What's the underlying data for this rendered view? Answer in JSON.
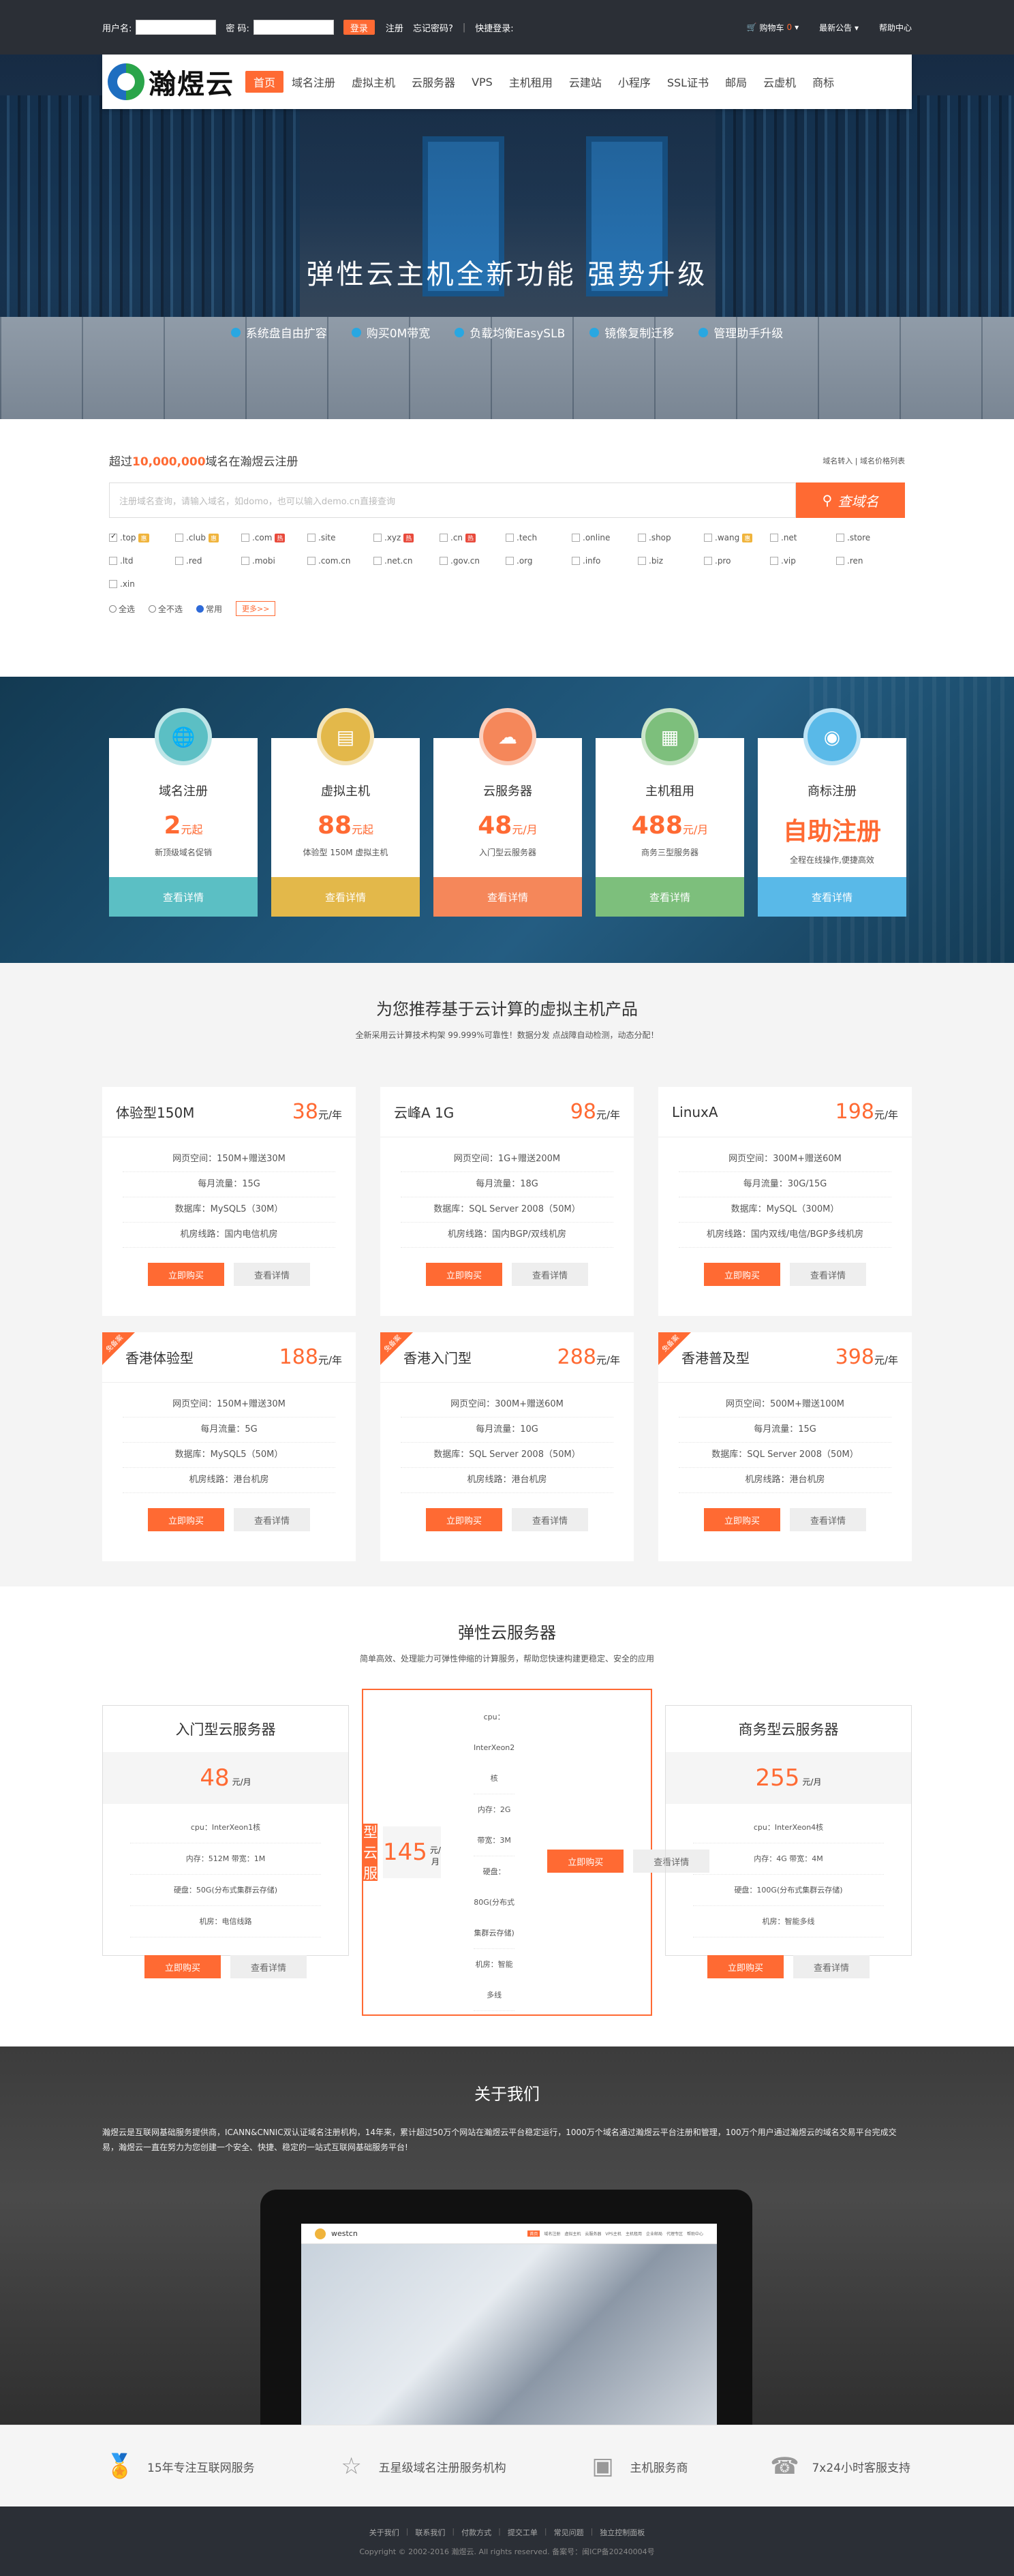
{
  "topbar": {
    "username_label": "用户名:",
    "password_label": "密 码:",
    "login_btn": "登录",
    "register": "注册",
    "forgot": "忘记密码?",
    "sep": "|",
    "quick_login": "快捷登录:",
    "cart_label": "购物车",
    "cart_count": "0",
    "notice": "最新公告",
    "help": "帮助中心"
  },
  "nav": {
    "logo_text": "瀚煜云",
    "items": [
      {
        "label": "首页"
      },
      {
        "label": "域名注册"
      },
      {
        "label": "虚拟主机"
      },
      {
        "label": "云服务器"
      },
      {
        "label": "VPS"
      },
      {
        "label": "主机租用"
      },
      {
        "label": "云建站"
      },
      {
        "label": "小程序"
      },
      {
        "label": "SSL证书"
      },
      {
        "label": "邮局"
      },
      {
        "label": "云虚机"
      },
      {
        "label": "商标"
      }
    ]
  },
  "hero": {
    "title": "弹性云主机全新功能  强势升级",
    "features": [
      "系统盘自由扩容",
      "购买0M带宽",
      "负载均衡EasySLB",
      "镜像复制迁移",
      "管理助手升级"
    ]
  },
  "domain": {
    "title_prefix": "超过",
    "title_count": "10,000,000",
    "title_suffix": "域名在瀚煜云注册",
    "link_transfer": "域名转入",
    "link_sep": "|",
    "link_price": "域名价格列表",
    "placeholder": "注册域名查询，请输入域名，如domo，也可以输入demo.cn直接查询",
    "search_btn": "查域名",
    "tlds": [
      {
        "name": ".top",
        "checked": true,
        "tag": "惠",
        "tag_type": "sale"
      },
      {
        "name": ".club",
        "checked": false,
        "tag": "惠",
        "tag_type": "sale"
      },
      {
        "name": ".com",
        "checked": false,
        "tag": "热",
        "tag_type": "new"
      },
      {
        "name": ".site",
        "checked": false,
        "tag": "",
        "tag_type": ""
      },
      {
        "name": ".xyz",
        "checked": false,
        "tag": "热",
        "tag_type": "new"
      },
      {
        "name": ".cn",
        "checked": false,
        "tag": "热",
        "tag_type": "new"
      },
      {
        "name": ".tech",
        "checked": false,
        "tag": "",
        "tag_type": ""
      },
      {
        "name": ".online",
        "checked": false,
        "tag": "",
        "tag_type": ""
      },
      {
        "name": ".shop",
        "checked": false,
        "tag": "",
        "tag_type": ""
      },
      {
        "name": ".wang",
        "checked": false,
        "tag": "惠",
        "tag_type": "sale"
      },
      {
        "name": ".net",
        "checked": false,
        "tag": "",
        "tag_type": ""
      },
      {
        "name": ".store",
        "checked": false,
        "tag": "",
        "tag_type": ""
      },
      {
        "name": ".ltd",
        "checked": false,
        "tag": "",
        "tag_type": ""
      },
      {
        "name": ".red",
        "checked": false,
        "tag": "",
        "tag_type": ""
      },
      {
        "name": ".mobi",
        "checked": false,
        "tag": "",
        "tag_type": ""
      },
      {
        "name": ".com.cn",
        "checked": false,
        "tag": "",
        "tag_type": ""
      },
      {
        "name": ".net.cn",
        "checked": false,
        "tag": "",
        "tag_type": ""
      },
      {
        "name": ".gov.cn",
        "checked": false,
        "tag": "",
        "tag_type": ""
      },
      {
        "name": ".org",
        "checked": false,
        "tag": "",
        "tag_type": ""
      },
      {
        "name": ".info",
        "checked": false,
        "tag": "",
        "tag_type": ""
      },
      {
        "name": ".biz",
        "checked": false,
        "tag": "",
        "tag_type": ""
      },
      {
        "name": ".pro",
        "checked": false,
        "tag": "",
        "tag_type": ""
      },
      {
        "name": ".vip",
        "checked": false,
        "tag": "",
        "tag_type": ""
      },
      {
        "name": ".ren",
        "checked": false,
        "tag": "",
        "tag_type": ""
      },
      {
        "name": ".xin",
        "checked": false,
        "tag": "",
        "tag_type": ""
      }
    ],
    "opt_all": "全选",
    "opt_none": "全不选",
    "opt_common": "常用",
    "more": "更多>>"
  },
  "services": [
    {
      "name": "域名注册",
      "price": "2",
      "unit": "元起",
      "desc": "新顶级域名促销",
      "btn": "查看详情",
      "color": "#5bbfc4",
      "icon": "globe-icon"
    },
    {
      "name": "虚拟主机",
      "price": "88",
      "unit": "元起",
      "desc": "体验型 150M 虚拟主机",
      "btn": "查看详情",
      "color": "#e3b84a",
      "icon": "server-icon"
    },
    {
      "name": "云服务器",
      "price": "48",
      "unit": "元/月",
      "desc": "入门型云服务器",
      "btn": "查看详情",
      "color": "#f5875a",
      "icon": "cloud-icon"
    },
    {
      "name": "主机租用",
      "price": "488",
      "unit": "元/月",
      "desc": "商务三型服务器",
      "btn": "查看详情",
      "color": "#7dbf7c",
      "icon": "rack-icon"
    },
    {
      "name": "商标注册",
      "price": "自助注册",
      "unit": "",
      "desc": "全程在线操作,便捷高效",
      "btn": "查看详情",
      "color": "#59b9e8",
      "icon": "trademark-icon"
    }
  ],
  "hosting": {
    "title": "为您推荐基于云计算的虚拟主机产品",
    "subtitle": "全新采用云计算技术构架 99.999%可靠性！数据分发 点战障自动检测，动态分配！",
    "plans": [
      {
        "name": "体验型150M",
        "price": "38",
        "unit": "元/年",
        "badge": "",
        "specs": [
          "网页空间：150M+赠送30M",
          "每月流量：15G",
          "数据库：MySQL5（30M）",
          "机房线路：国内电信机房"
        ]
      },
      {
        "name": "云峰A 1G",
        "price": "98",
        "unit": "元/年",
        "badge": "",
        "specs": [
          "网页空间：1G+赠送200M",
          "每月流量：18G",
          "数据库：SQL Server 2008（50M）",
          "机房线路：国内BGP/双线机房"
        ]
      },
      {
        "name": "LinuxA",
        "price": "198",
        "unit": "元/年",
        "badge": "",
        "specs": [
          "网页空间：300M+赠送60M",
          "每月流量：30G/15G",
          "数据库：MySQL（300M）",
          "机房线路：国内双线/电信/BGP多线机房"
        ]
      },
      {
        "name": "香港体验型",
        "price": "188",
        "unit": "元/年",
        "badge": "免备案",
        "specs": [
          "网页空间：150M+赠送30M",
          "每月流量：5G",
          "数据库：MySQL5（50M）",
          "机房线路：港台机房"
        ]
      },
      {
        "name": "香港入门型",
        "price": "288",
        "unit": "元/年",
        "badge": "免备案",
        "specs": [
          "网页空间：300M+赠送60M",
          "每月流量：10G",
          "数据库：SQL Server 2008（50M）",
          "机房线路：港台机房"
        ]
      },
      {
        "name": "香港普及型",
        "price": "398",
        "unit": "元/年",
        "badge": "免备案",
        "specs": [
          "网页空间：500M+赠送100M",
          "每月流量：15G",
          "数据库：SQL Server 2008（50M）",
          "机房线路：港台机房"
        ]
      }
    ],
    "buy": "立即购买",
    "detail": "查看详情"
  },
  "cloud": {
    "title": "弹性云服务器",
    "subtitle": "简单高效、处理能力可弹性伸缩的计算服务，帮助您快速构建更稳定、安全的应用",
    "plans": [
      {
        "name": "入门型云服务器",
        "price": "48",
        "unit": "元/月",
        "featured": false,
        "specs": [
          "cpu：InterXeon1核",
          "内存：512M   带宽：1M",
          "硬盘：50G(分布式集群云存储)",
          "机房：电信线路"
        ]
      },
      {
        "name": "标准型云服务器",
        "price": "145",
        "unit": "元/月",
        "featured": true,
        "specs": [
          "cpu：InterXeon2核",
          "内存：2G   带宽：3M",
          "硬盘：80G(分布式集群云存储)",
          "机房：智能多线"
        ]
      },
      {
        "name": "商务型云服务器",
        "price": "255",
        "unit": "元/月",
        "featured": false,
        "specs": [
          "cpu：InterXeon4核",
          "内存：4G   带宽：4M",
          "硬盘：100G(分布式集群云存储)",
          "机房：智能多线"
        ]
      }
    ],
    "buy": "立即购买",
    "detail": "查看详情"
  },
  "about": {
    "title": "关于我们",
    "text": "瀚煜云是互联网基础服务提供商，ICANN&CNNIC双认证域名注册机构，14年来，累计超过50万个网站在瀚煜云平台稳定运行，1000万个域名通过瀚煜云平台注册和管理，100万个用户通过瀚煜云的域名交易平台完成交易，瀚煜云一直在努力为您创建一个安全、快捷、稳定的一站式互联网基础服务平台!",
    "tablet_brand": "westcn",
    "tablet_nav": [
      "首页",
      "域名注册",
      "虚拟主机",
      "云服务器",
      "VPS主机",
      "主机租用",
      "企业邮局",
      "代理专区",
      "帮助中心"
    ]
  },
  "features": [
    {
      "label": "15年专注互联网服务",
      "icon": "medal-icon"
    },
    {
      "label": "五星级域名注册服务机构",
      "icon": "stars-icon"
    },
    {
      "label": "主机服务商",
      "icon": "calendar-icon"
    },
    {
      "label": "7x24小时客服支持",
      "icon": "phone-icon"
    }
  ],
  "footer": {
    "links": [
      "关于我们",
      "联系我们",
      "付款方式",
      "提交工单",
      "常见问题",
      "独立控制面板"
    ],
    "sep": "|",
    "copyright": "Copyright © 2002-2016 瀚煜云. All rights reserved.   备案号：闽ICP备20240004号"
  }
}
